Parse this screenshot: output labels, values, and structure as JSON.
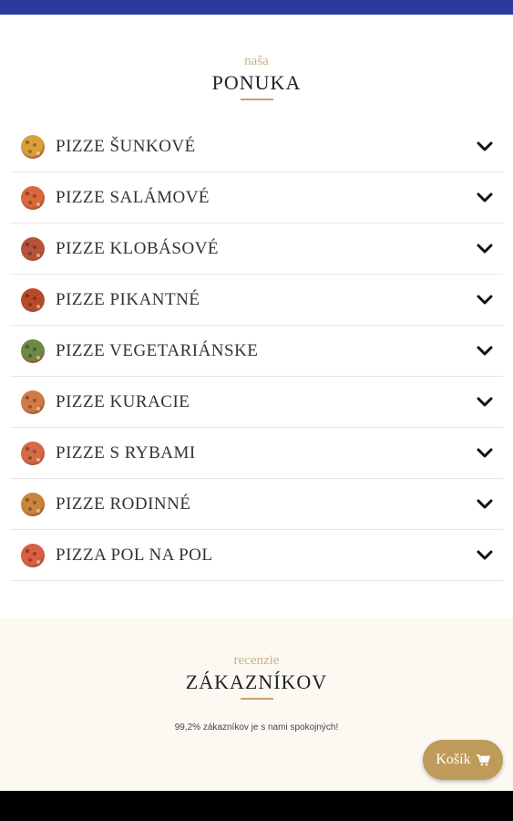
{
  "menu_section": {
    "kicker": "naša",
    "title": "PONUKA"
  },
  "menu_items": [
    {
      "label": "PIZZE ŠUNKOVÉ",
      "icon": "pizza-icon",
      "color": "#d9a03a"
    },
    {
      "label": "PIZZE SALÁMOVÉ",
      "icon": "pizza-icon",
      "color": "#d8683a"
    },
    {
      "label": "PIZZE KLOBÁSOVÉ",
      "icon": "pizza-icon",
      "color": "#b5533a"
    },
    {
      "label": "PIZZE PIKANTNÉ",
      "icon": "pizza-icon",
      "color": "#b84a2c"
    },
    {
      "label": "PIZZE VEGETARIÁNSKE",
      "icon": "pizza-icon",
      "color": "#6a8a45"
    },
    {
      "label": "PIZZE KURACIE",
      "icon": "pizza-icon",
      "color": "#d07a45"
    },
    {
      "label": "PIZZE S RYBAMI",
      "icon": "pizza-icon",
      "color": "#d56a45"
    },
    {
      "label": "PIZZE RODINNÉ",
      "icon": "pizza-icon",
      "color": "#c9853d"
    },
    {
      "label": "PIZZA POL NA POL",
      "icon": "pizza-icon",
      "color": "#d85f45"
    }
  ],
  "reviews_section": {
    "kicker": "recenzie",
    "title": "ZÁKAZNÍKOV",
    "text": "99,2% zákazníkov je s nami spokojných!"
  },
  "cart": {
    "label": "Košík",
    "icon": "cart-icon"
  },
  "colors": {
    "topbar": "#2b3a9e",
    "accent": "#c8a462",
    "cart": "#bf9b5b",
    "reviews_bg": "#fcf9f3"
  }
}
